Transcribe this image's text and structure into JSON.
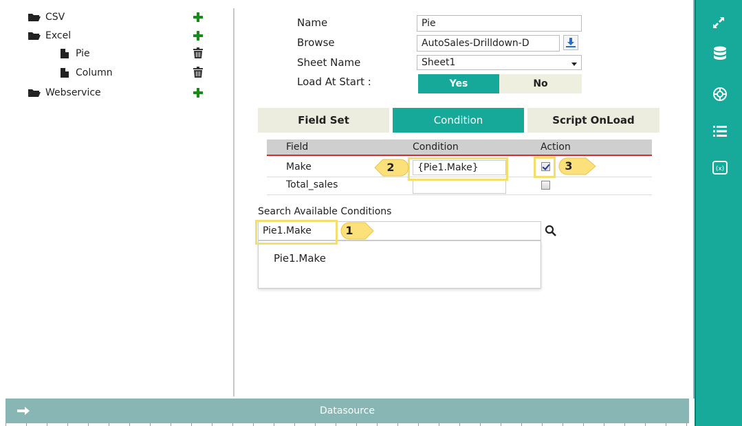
{
  "tree": {
    "items": [
      {
        "label": "CSV",
        "type": "folder",
        "action": "add"
      },
      {
        "label": "Excel",
        "type": "folder",
        "action": "add"
      },
      {
        "label": "Pie",
        "type": "file",
        "action": "delete"
      },
      {
        "label": "Column",
        "type": "file",
        "action": "delete"
      },
      {
        "label": "Webservice",
        "type": "folder",
        "action": "add"
      }
    ]
  },
  "form": {
    "name_label": "Name",
    "name_value": "Pie",
    "browse_label": "Browse",
    "browse_value": "AutoSales-Drilldown-D",
    "sheet_label": "Sheet Name",
    "sheet_value": "Sheet1",
    "load_label": "Load At Start :",
    "yes_label": "Yes",
    "no_label": "No",
    "load_selected": "Yes"
  },
  "tabs": [
    {
      "label": "Field Set",
      "active": false
    },
    {
      "label": "Condition",
      "active": true
    },
    {
      "label": "Script OnLoad",
      "active": false
    }
  ],
  "grid": {
    "headers": [
      "Field",
      "Condition",
      "Action"
    ],
    "rows": [
      {
        "field": "Make",
        "condition": "{Pie1.Make}",
        "checked": true
      },
      {
        "field": "Total_sales",
        "condition": "",
        "checked": false
      }
    ]
  },
  "search": {
    "label": "Search Available Conditions",
    "value": "Pie1.Make",
    "results": [
      "Pie1.Make"
    ]
  },
  "callouts": [
    "1",
    "2",
    "3"
  ],
  "footer": {
    "title": "Datasource"
  },
  "toolbar": {
    "icons": [
      "expand-icon",
      "database-icon",
      "globe-settings-icon",
      "list-icon",
      "formula-icon"
    ]
  },
  "colors": {
    "accent": "#16a999",
    "footer": "#87b6b4",
    "highlight": "#f3de6e",
    "callout": "#fce07a"
  }
}
